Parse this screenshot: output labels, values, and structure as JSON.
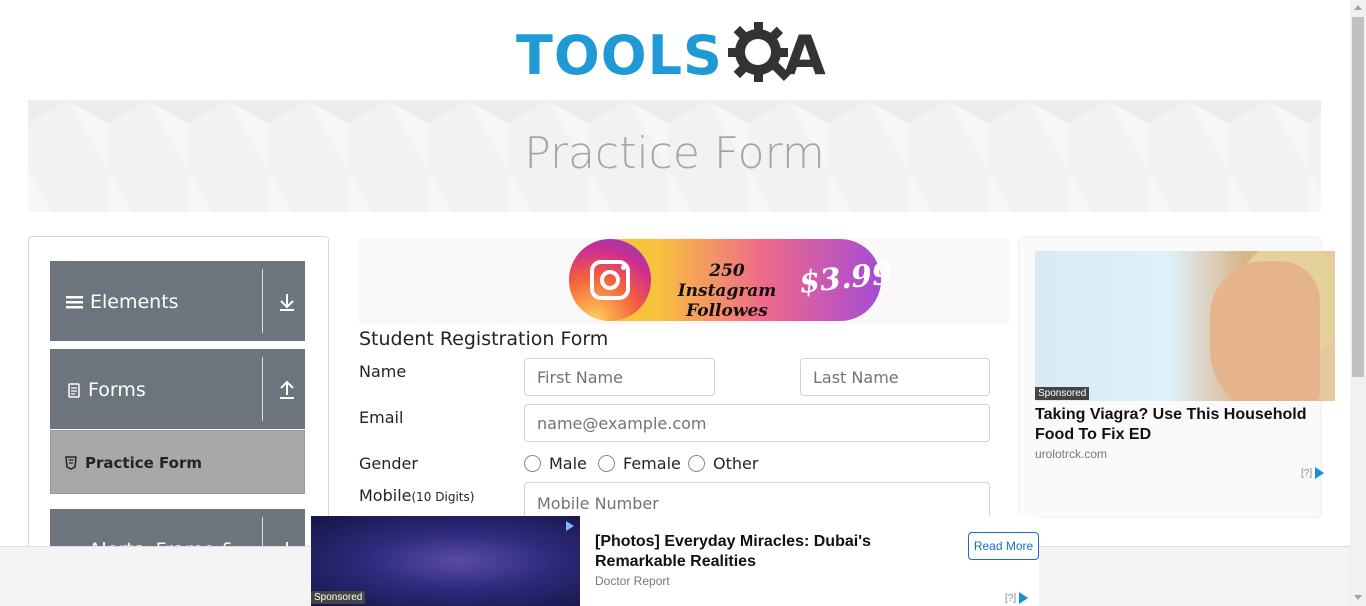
{
  "logo": {
    "text_primary": "TOOLS",
    "text_secondary": "A",
    "primary_color": "#1f9ad6",
    "secondary_color": "#333333"
  },
  "banner": {
    "title": "Practice Form"
  },
  "sidebar": {
    "groups": [
      {
        "label": "Elements",
        "icon": "hamburger-icon",
        "arrow": "download-arrow-icon"
      },
      {
        "label": "Forms",
        "icon": "document-icon",
        "arrow": "upload-arrow-icon"
      },
      {
        "label": "Alerts, Frame & Windows",
        "icon": "window-icon",
        "arrow": "download-arrow-icon"
      }
    ],
    "active_item": {
      "label": "Practice Form",
      "icon": "html5-icon"
    }
  },
  "top_ad": {
    "text": "250 Instagram Followes",
    "price": "$3.99"
  },
  "form": {
    "title": "Student Registration Form",
    "name_label": "Name",
    "first_name_placeholder": "First Name",
    "last_name_placeholder": "Last Name",
    "email_label": "Email",
    "email_placeholder": "name@example.com",
    "gender_label": "Gender",
    "gender_options": [
      "Male",
      "Female",
      "Other"
    ],
    "mobile_label": "Mobile",
    "mobile_hint": "(10 Digits)",
    "mobile_placeholder": "Mobile Number"
  },
  "right_ad": {
    "sponsored": "Sponsored",
    "headline": "Taking Viagra? Use This Household Food To Fix ED",
    "domain": "urolotrck.com",
    "adchoices": "[?]"
  },
  "bottom_ad": {
    "sponsored": "Sponsored",
    "headline": "[Photos] Everyday Miracles: Dubai's Remarkable Realities",
    "source": "Doctor Report",
    "button": "Read More",
    "adchoices": "[?]"
  }
}
